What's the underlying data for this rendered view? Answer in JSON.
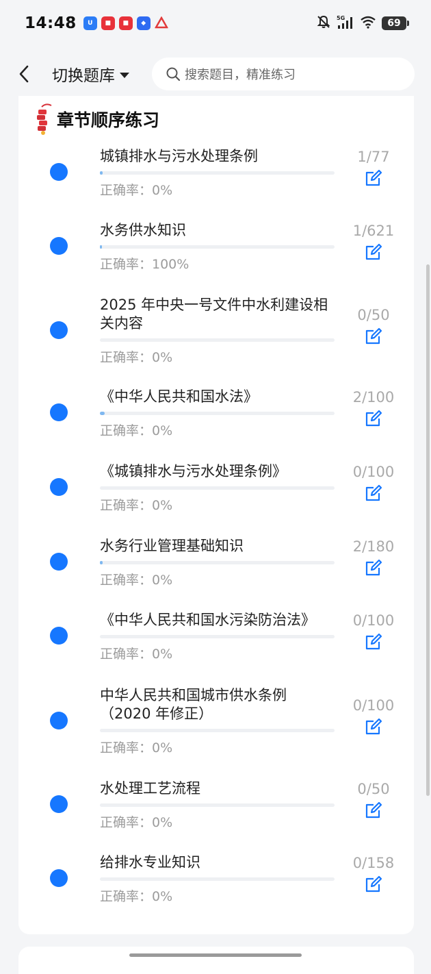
{
  "status": {
    "time": "14:48",
    "battery": "69",
    "network": "5G"
  },
  "header": {
    "bank_switch_label": "切换题库",
    "search_placeholder": "搜索题目，精准练习"
  },
  "section": {
    "title": "章节顺序练习"
  },
  "chapters": [
    {
      "name": "城镇排水与污水处理条例",
      "accuracy": "正确率：0%",
      "count": "1/77",
      "done": 1,
      "total": 77
    },
    {
      "name": "水务供水知识",
      "accuracy": "正确率：100%",
      "count": "1/621",
      "done": 1,
      "total": 621
    },
    {
      "name": "2025 年中央一号文件中水利建设相关内容",
      "accuracy": "正确率：0%",
      "count": "0/50",
      "done": 0,
      "total": 50
    },
    {
      "name": "《中华人民共和国水法》",
      "accuracy": "正确率：0%",
      "count": "2/100",
      "done": 2,
      "total": 100
    },
    {
      "name": "《城镇排水与污水处理条例》",
      "accuracy": "正确率：0%",
      "count": "0/100",
      "done": 0,
      "total": 100
    },
    {
      "name": "水务行业管理基础知识",
      "accuracy": "正确率：0%",
      "count": "2/180",
      "done": 2,
      "total": 180
    },
    {
      "name": "《中华人民共和国水污染防治法》",
      "accuracy": "正确率：0%",
      "count": "0/100",
      "done": 0,
      "total": 100
    },
    {
      "name": "中华人民共和国城市供水条例（2020 年修正）",
      "accuracy": "正确率：0%",
      "count": "0/100",
      "done": 0,
      "total": 100
    },
    {
      "name": "水处理工艺流程",
      "accuracy": "正确率：0%",
      "count": "0/50",
      "done": 0,
      "total": 50
    },
    {
      "name": "给排水专业知识",
      "accuracy": "正确率：0%",
      "count": "0/158",
      "done": 0,
      "total": 158
    }
  ],
  "colors": {
    "accent": "#1677ff",
    "progress_fill": "#7fb8f0"
  },
  "icons": {
    "back": "chevron-left-icon",
    "dropdown": "caret-down-icon",
    "search": "search-icon",
    "section": "firecracker-icon",
    "practice": "edit-icon"
  }
}
